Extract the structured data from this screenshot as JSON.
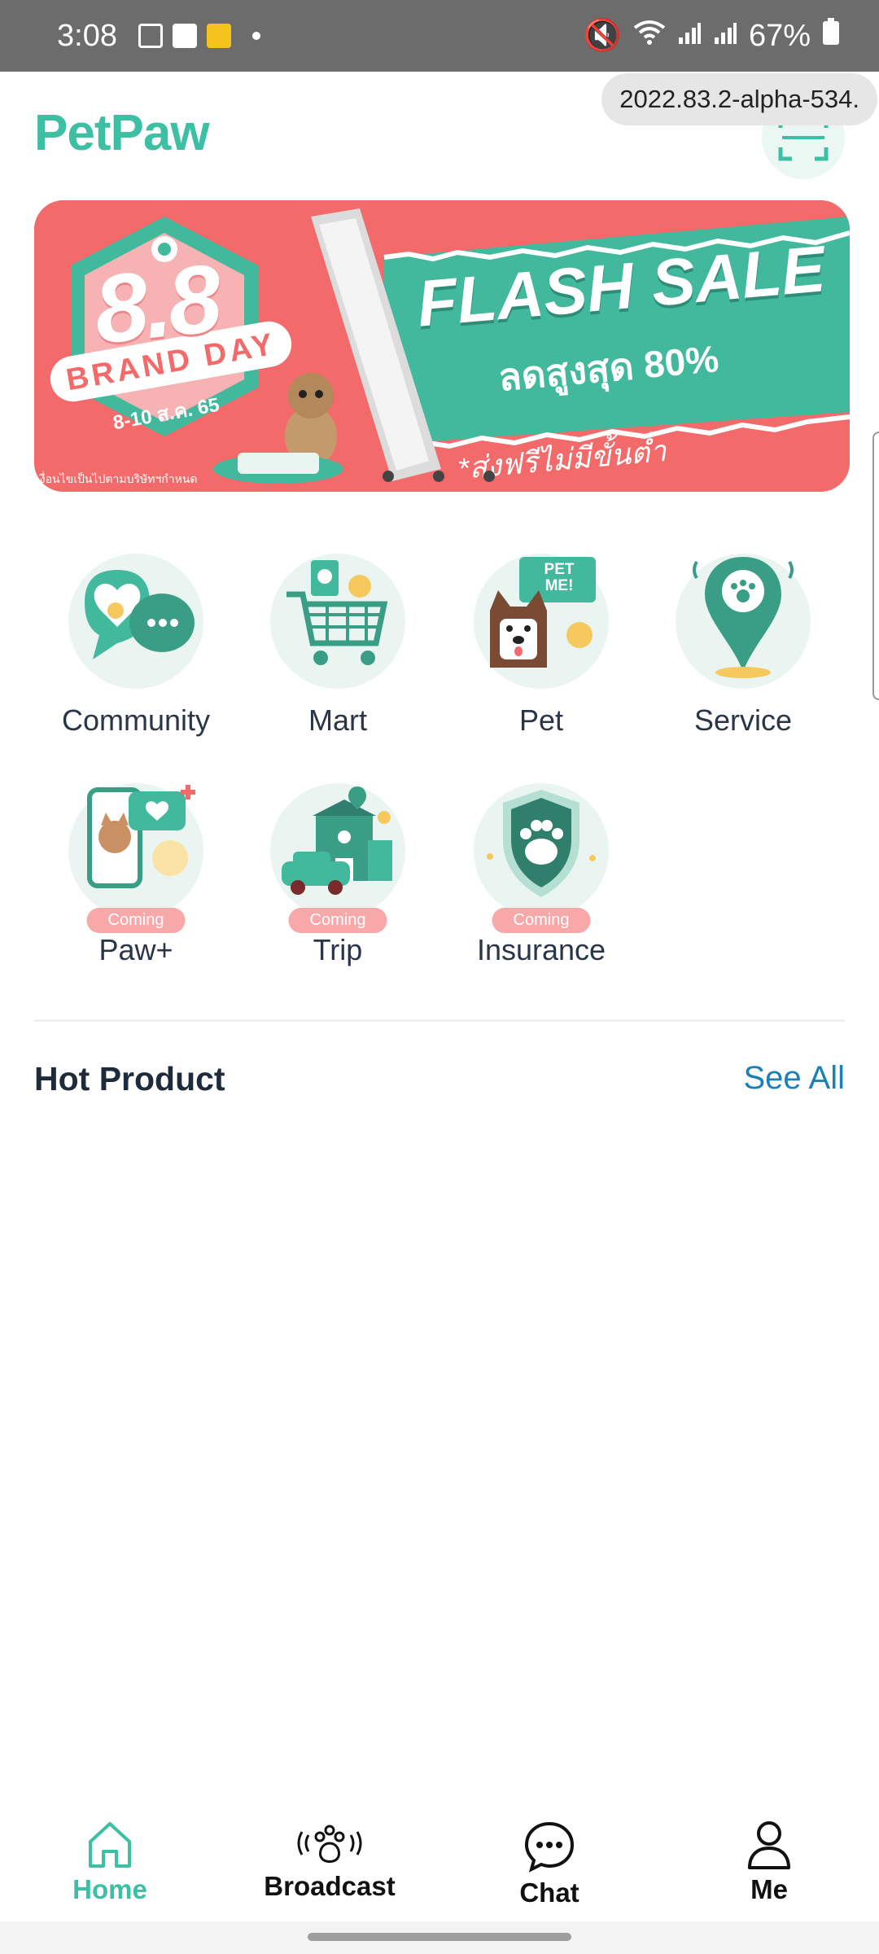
{
  "status_bar": {
    "time": "3:08",
    "battery": "67%"
  },
  "header": {
    "app_title": "PetPaw",
    "version": "2022.83.2-alpha-534."
  },
  "banner": {
    "brand_day_number": "8.8",
    "brand_day_text": "BRAND DAY",
    "date_text": "8-10 ส.ค. 65",
    "flash_sale_title": "FLASH SALE",
    "discount_text": "ลดสูงสุด 80%",
    "shipping_text": "*ส่งฟรีไม่มีขั้นต่ำ",
    "fine_print": "เงื่อนไขเป็นไปตามบริษัทฯกำหนด",
    "colors": {
      "bg": "#f26a6a",
      "teal": "#42b89d"
    }
  },
  "categories": [
    {
      "label": "Community",
      "icon": "chat-heart-icon"
    },
    {
      "label": "Mart",
      "icon": "shopping-cart-icon"
    },
    {
      "label": "Pet",
      "icon": "dog-sign-icon",
      "sign": "PET ME!"
    },
    {
      "label": "Service",
      "icon": "location-pin-icon"
    },
    {
      "label": "Paw+",
      "icon": "phone-cat-icon",
      "badge": "Coming"
    },
    {
      "label": "Trip",
      "icon": "car-hotel-icon",
      "badge": "Coming"
    },
    {
      "label": "Insurance",
      "icon": "shield-paw-icon",
      "badge": "Coming"
    }
  ],
  "hot_product": {
    "title": "Hot Product",
    "see_all": "See All"
  },
  "bottom_nav": {
    "home": "Home",
    "broadcast": "Broadcast",
    "chat": "Chat",
    "me": "Me"
  },
  "colors": {
    "accent": "#3cbfa3",
    "link": "#1b7fb8"
  }
}
